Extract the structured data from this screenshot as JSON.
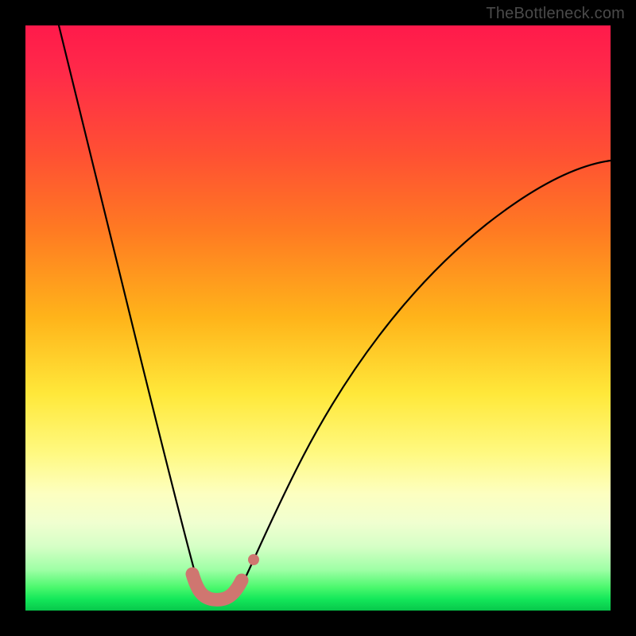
{
  "watermark": "TheBottleneck.com",
  "chart_data": {
    "type": "line",
    "title": "",
    "xlabel": "",
    "ylabel": "",
    "xlim": [
      0,
      100
    ],
    "ylim": [
      0,
      100
    ],
    "note": "No axis ticks or numeric labels are shown; values below are pixel-read estimates on a 0–100 normalized scale.",
    "series": [
      {
        "name": "left-descending-curve",
        "x": [
          5,
          8,
          12,
          16,
          20,
          24,
          26,
          28,
          29.5
        ],
        "y": [
          100,
          80,
          58,
          40,
          24,
          11,
          6,
          3,
          1.5
        ]
      },
      {
        "name": "valley-floor",
        "x": [
          29.5,
          31,
          33,
          35,
          36.5
        ],
        "y": [
          1.5,
          0.8,
          0.6,
          0.8,
          1.5
        ]
      },
      {
        "name": "right-ascending-curve",
        "x": [
          36.5,
          40,
          46,
          54,
          62,
          72,
          84,
          96,
          100
        ],
        "y": [
          1.5,
          6,
          16,
          28,
          40,
          52,
          63,
          72,
          75
        ]
      },
      {
        "name": "valley-highlight-band",
        "style": "thick-rounded",
        "color": "#d2766e",
        "x": [
          28.5,
          30,
          32,
          34,
          36,
          37.5
        ],
        "y": [
          4,
          1.5,
          0.8,
          0.8,
          1.5,
          4
        ]
      },
      {
        "name": "highlight-dot",
        "style": "point",
        "color": "#d2766e",
        "x": [
          39.5
        ],
        "y": [
          8
        ]
      }
    ]
  }
}
